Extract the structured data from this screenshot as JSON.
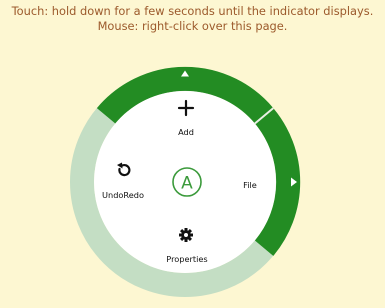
{
  "instructions": {
    "touch": "Touch: hold down for a few seconds until the indicator displays.",
    "mouse": "Mouse: right-click over this page."
  },
  "menu": {
    "center_letter": "A",
    "items": {
      "add": {
        "label": "Add",
        "icon": "plus-icon"
      },
      "file": {
        "label": "File",
        "icon": "none",
        "has_submenu": true
      },
      "properties": {
        "label": "Properties",
        "icon": "gear-icon"
      },
      "undoredo": {
        "label": "UndoRedo",
        "icon": "undo-icon"
      }
    },
    "colors": {
      "background": "#fdf7d2",
      "instruction_text": "#9c5a2c",
      "active_ring": "#238c23",
      "inactive_ring": "#c4dec4",
      "center_ring": "#3b9a3b"
    }
  }
}
